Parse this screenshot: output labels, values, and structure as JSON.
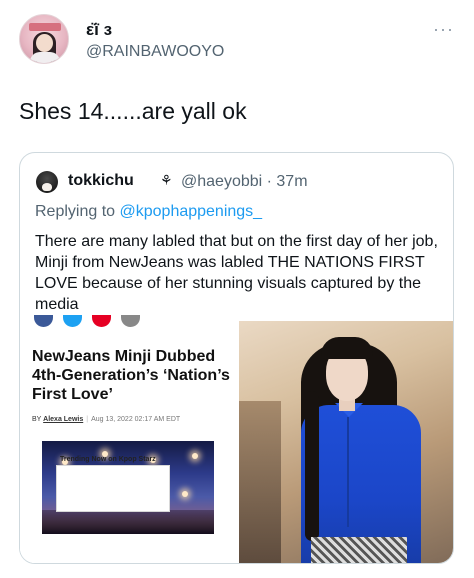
{
  "tweet": {
    "display_name": "ε̈ї з",
    "handle": "@RAINBAWOOYO",
    "more_icon": "more-horizontal-icon",
    "text": "Shes 14......are yall ok"
  },
  "quote": {
    "name": "tokkichu",
    "name_icon": "⚘",
    "handle_time": "@haeyobbi · 37m",
    "replying_prefix": "Replying to ",
    "replying_to": "@kpophappenings_",
    "body": "There are many labled that but on the first day of her job, Minji from NewJeans was labled THE NATIONS FIRST LOVE because of her stunning visuals captured by the media"
  },
  "article": {
    "share_colors": [
      "#3b5998",
      "#1da1f2",
      "#e60023",
      "#888888"
    ],
    "title": "NewJeans Minji Dubbed 4th-Generation’s ‘Nation’s First Love’",
    "byline_prefix": "BY ",
    "author": "Alexa Lewis",
    "separator": "|",
    "date": "Aug 13, 2022 02:17 AM EDT",
    "trending": "Trending Now on Kpop Starz"
  },
  "colors": {
    "accent": "#1d9bf0",
    "secondary_text": "#536471",
    "border": "#cfd9de"
  }
}
